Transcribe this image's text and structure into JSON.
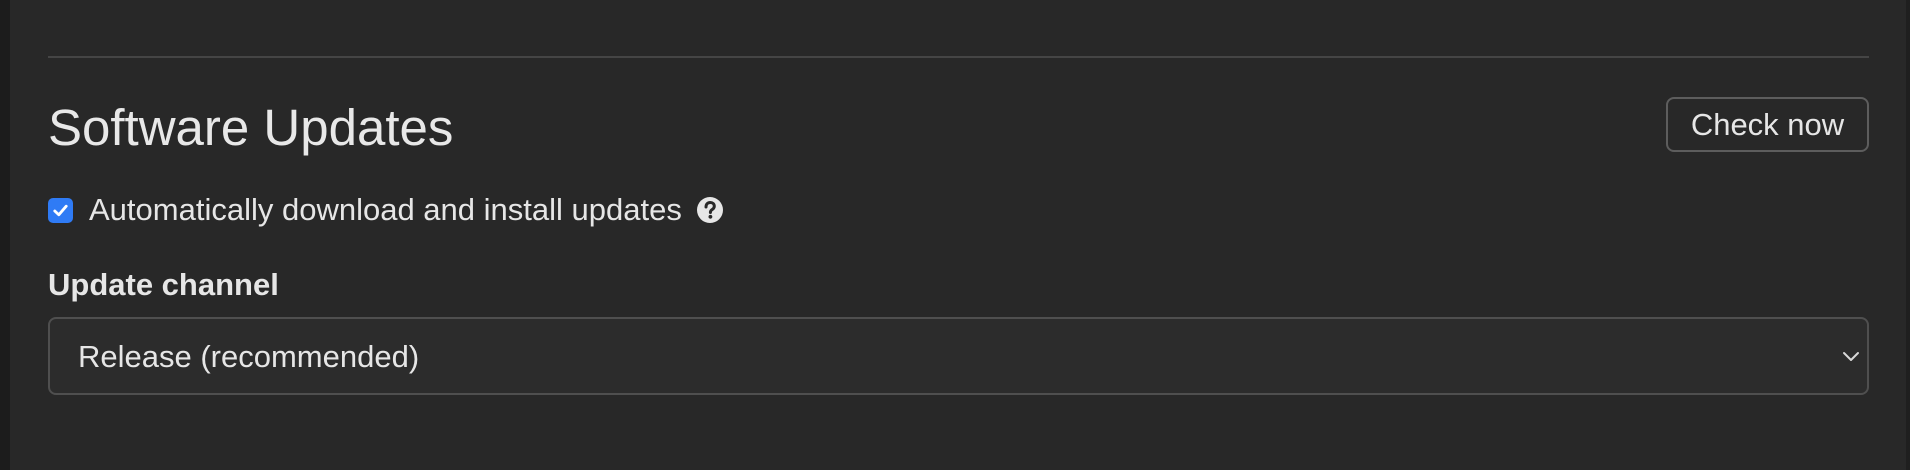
{
  "software_updates": {
    "title": "Software Updates",
    "check_now_label": "Check now",
    "auto_update": {
      "label": "Automatically download and install updates",
      "checked": true,
      "help_icon": "question-circle-icon"
    },
    "update_channel": {
      "label": "Update channel",
      "selected_value": "Release (recommended)",
      "dropdown_icon": "chevron-down-icon"
    }
  },
  "colors": {
    "background": "#282828",
    "checkbox_accent": "#2f7bf5",
    "text": "#e6e6e6"
  }
}
